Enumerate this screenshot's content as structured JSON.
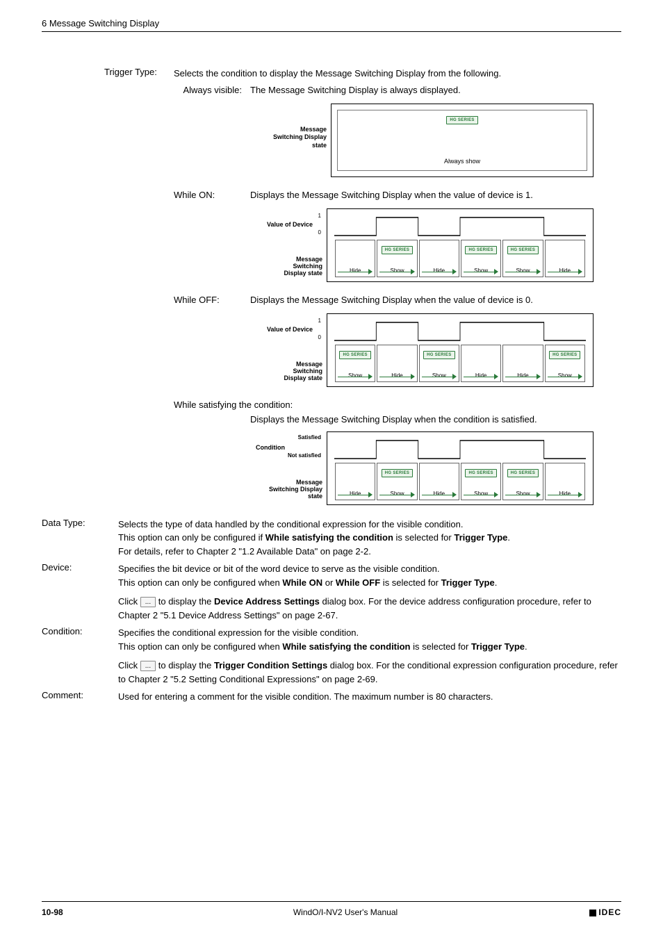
{
  "header": "6 Message Switching Display",
  "triggerType": {
    "label": "Trigger Type:",
    "desc": "Selects the condition to display the Message Switching Display from the following.",
    "alwaysVisible": {
      "label": "Always visible:",
      "desc": "The Message Switching Display is always displayed.",
      "axis": "Message\nSwitching Display\nstate",
      "caption": "Always show",
      "hg": "HG SERIES"
    },
    "whileOn": {
      "label": "While ON:",
      "desc": "Displays the Message Switching Display when the value of device is 1.",
      "valueAxis": "Value of Device",
      "tick1": "1",
      "tick0": "0",
      "stateAxis": "Message\nSwitching\nDisplay state",
      "cells": [
        "Hide",
        "Show",
        "Hide",
        "Show",
        "Show",
        "Hide"
      ],
      "hg": "HG SERIES"
    },
    "whileOff": {
      "label": "While OFF:",
      "desc": "Displays the Message Switching Display when the value of device is 0.",
      "valueAxis": "Value of Device",
      "tick1": "1",
      "tick0": "0",
      "stateAxis": "Message\nSwitching\nDisplay state",
      "cells": [
        "Show",
        "Hide",
        "Show",
        "Hide",
        "Hide",
        "Show"
      ],
      "hg": "HG SERIES"
    },
    "whileCond": {
      "label": "While satisfying the condition:",
      "desc": "Displays the Message Switching Display when the condition is satisfied.",
      "valueAxis": "Condition",
      "tickTop": "Satisfied",
      "tickBot": "Not satisfied",
      "stateAxis": "Message\nSwitching Display\nstate",
      "cells": [
        "Hide",
        "Show",
        "Hide",
        "Show",
        "Show",
        "Hide"
      ],
      "hg": "HG SERIES"
    }
  },
  "dataType": {
    "label": "Data Type:",
    "l1": "Selects the type of data handled by the conditional expression for the visible condition.",
    "l2a": "This option can only be configured if ",
    "l2b": "While satisfying the condition",
    "l2c": " is selected for ",
    "l2d": "Trigger Type",
    "l2e": ".",
    "l3": "For details, refer to Chapter 2 \"1.2 Available Data\" on page 2-2."
  },
  "device": {
    "label": "Device:",
    "l1": "Specifies the bit device or bit of the word device to serve as the visible condition.",
    "l2a": "This option can only be configured when ",
    "l2b": "While ON",
    "l2c": " or ",
    "l2d": "While OFF",
    "l2e": " is selected for ",
    "l2f": "Trigger Type",
    "l2g": ".",
    "l3a": "Click ",
    "btn": "...",
    "l3b": " to display the ",
    "l3c": "Device Address Settings",
    "l3d": " dialog box. For the device address configuration procedure, refer to Chapter 2 \"5.1 Device Address Settings\" on page 2-67."
  },
  "condition": {
    "label": "Condition:",
    "l1": "Specifies the conditional expression for the visible condition.",
    "l2a": "This option can only be configured when ",
    "l2b": "While satisfying the condition",
    "l2c": " is selected for ",
    "l2d": "Trigger Type",
    "l2e": ".",
    "l3a": "Click ",
    "btn": "...",
    "l3b": " to display the ",
    "l3c": "Trigger Condition Settings",
    "l3d": " dialog box. For the conditional expression configuration procedure, refer to Chapter 2 \"5.2 Setting Conditional Expressions\" on page 2-69."
  },
  "comment": {
    "label": "Comment:",
    "l1": "Used for entering a comment for the visible condition. The maximum number is 80 characters."
  },
  "footer": {
    "page": "10-98",
    "title": "WindO/I-NV2 User's Manual",
    "logo": "IDEC"
  }
}
